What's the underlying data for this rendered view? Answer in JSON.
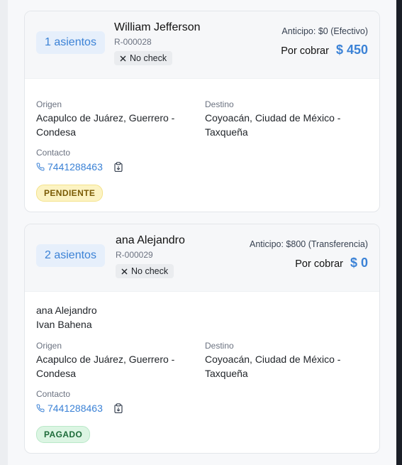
{
  "reservations": [
    {
      "seats": "1 asientos",
      "name": "William Jefferson",
      "ref": "R-000028",
      "check_label": "No check",
      "anticipo": "Anticipo: $0 (Efectivo)",
      "por_cobrar_label": "Por cobrar",
      "por_cobrar_amount": "$ 450",
      "passengers": [],
      "origin_label": "Origen",
      "origin": "Acapulco de Juárez, Guerrero - Condesa",
      "dest_label": "Destino",
      "dest": "Coyoacán, Ciudad de México - Taxqueña",
      "contact_label": "Contacto",
      "phone": "7441288463",
      "status": "PENDIENTE"
    },
    {
      "seats": "2 asientos",
      "name": "ana Alejandro",
      "ref": "R-000029",
      "check_label": "No check",
      "anticipo": "Anticipo: $800 (Transferencia)",
      "por_cobrar_label": "Por cobrar",
      "por_cobrar_amount": "$ 0",
      "passengers": [
        "ana Alejandro",
        "Ivan Bahena"
      ],
      "origin_label": "Origen",
      "origin": "Acapulco de Juárez, Guerrero - Condesa",
      "dest_label": "Destino",
      "dest": "Coyoacán, Ciudad de México - Taxqueña",
      "contact_label": "Contacto",
      "phone": "7441288463",
      "status": "PAGADO"
    }
  ],
  "colors": {
    "accent": "#3b82d6",
    "pending_bg": "#fcf3c3",
    "paid_bg": "#dcf5e3"
  }
}
